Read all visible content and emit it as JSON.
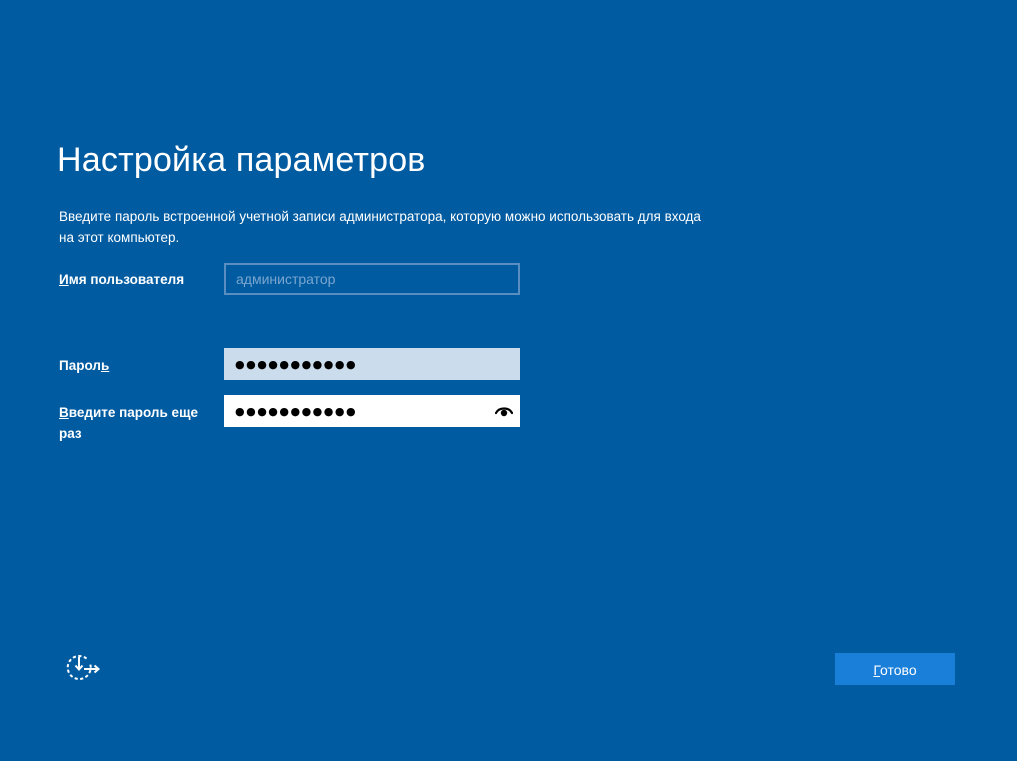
{
  "page": {
    "title": "Настройка параметров",
    "description": "Введите пароль встроенной учетной записи администратора, которую можно использовать для входа на этот компьютер."
  },
  "fields": {
    "username": {
      "label_access_key": "И",
      "label_rest": "мя пользователя",
      "placeholder": "администратор",
      "value": ""
    },
    "password": {
      "label_before": "Парол",
      "label_access_key": "ь",
      "masked_value": "●●●●●●●●●●●"
    },
    "confirm_password": {
      "label_access_key": "В",
      "label_rest": "ведите пароль еще раз",
      "masked_value": "●●●●●●●●●●●"
    }
  },
  "footer": {
    "done_access_key": "Г",
    "done_rest": "отово"
  },
  "icons": {
    "reveal": "eye-icon",
    "accessibility": "ease-of-access-icon"
  },
  "colors": {
    "background": "#005ba1",
    "button": "#1a7fd9",
    "text": "#ffffff"
  }
}
